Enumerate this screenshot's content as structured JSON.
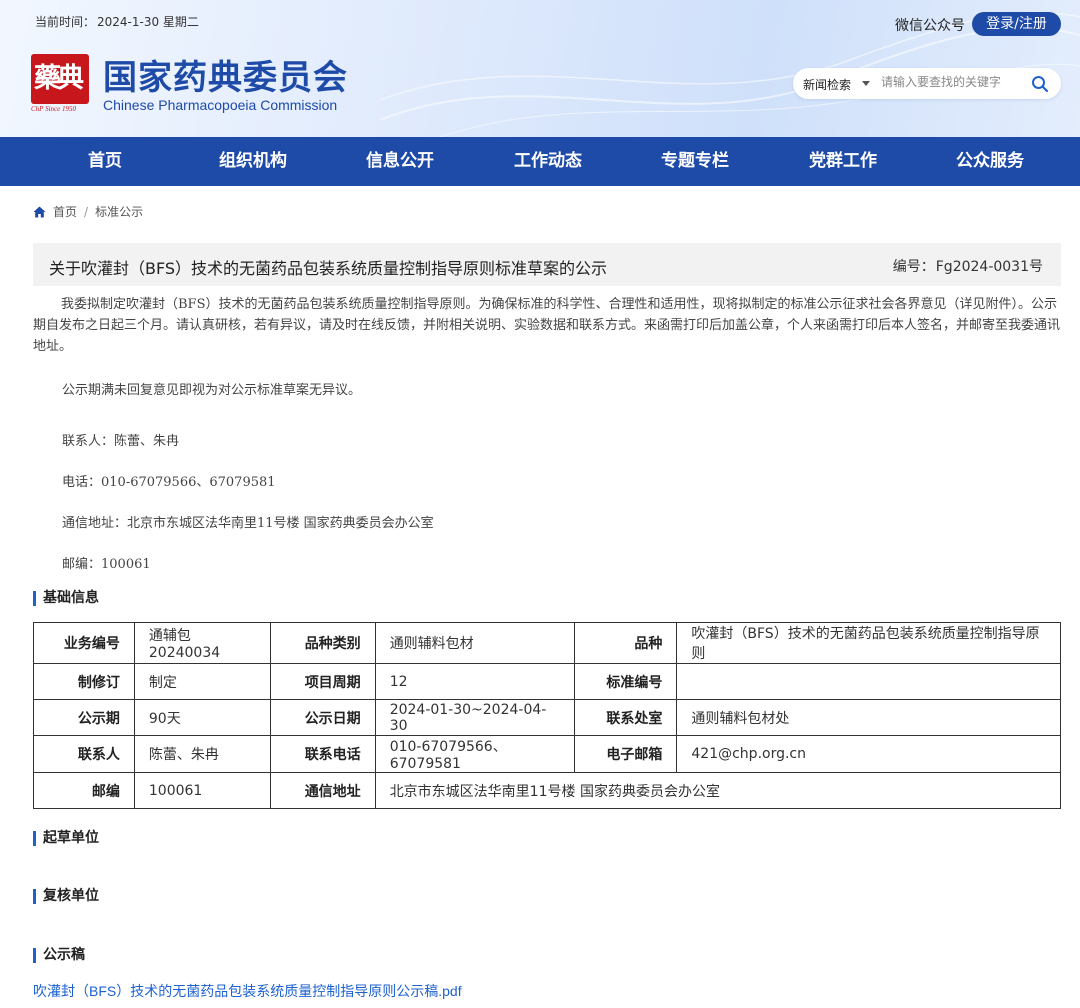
{
  "header": {
    "date_label": "当前时间：",
    "date_value": "2024-1-30 星期二",
    "seal_text": "藥典",
    "seal_sub": "ChP Since 1950",
    "logo_cn": "国家药典委员会",
    "logo_en": "Chinese Pharmacopoeia Commission",
    "wechat": "微信公众号",
    "login": "登录/注册",
    "search": {
      "category": "新闻检索",
      "placeholder": "请输入要查找的关键字"
    }
  },
  "nav": [
    "首页",
    "组织机构",
    "信息公开",
    "工作动态",
    "专题专栏",
    "党群工作",
    "公众服务"
  ],
  "breadcrumb": {
    "home": "首页",
    "sep": "/",
    "current": "标准公示"
  },
  "article": {
    "title": "关于吹灌封（BFS）技术的无菌药品包装系统质量控制指导原则标准草案的公示",
    "code_label": "编号：",
    "code": "Fg2024-0031号",
    "para": "我委拟制定吹灌封（BFS）技术的无菌药品包装系统质量控制指导原则。为确保标准的科学性、合理性和适用性，现将拟制定的标准公示征求社会各界意见（详见附件）。公示期自发布之日起三个月。请认真研核，若有异议，请及时在线反馈，并附相关说明、实验数据和联系方式。来函需打印后加盖公章，个人来函需打印后本人签名，并邮寄至我委通讯地址。",
    "line1": "公示期满未回复意见即视为对公示标准草案无异议。",
    "line2": "联系人：陈蕾、朱冉",
    "line3": "电话：010-67079566、67079581",
    "line4": "通信地址：北京市东城区法华南里11号楼 国家药典委员会办公室",
    "line5": "邮编：100061"
  },
  "sections": {
    "basic": "基础信息",
    "draft": "起草单位",
    "review": "复核单位",
    "doc": "公示稿"
  },
  "table": [
    [
      "业务编号",
      "通辅包20240034",
      "品种类别",
      "通则辅料包材",
      "品种",
      "吹灌封（BFS）技术的无菌药品包装系统质量控制指导原则"
    ],
    [
      "制修订",
      "制定",
      "项目周期",
      "12",
      "标准编号",
      ""
    ],
    [
      "公示期",
      "90天",
      "公示日期",
      "2024-01-30~2024-04-30",
      "联系处室",
      "通则辅料包材处"
    ],
    [
      "联系人",
      "陈蕾、朱冉",
      "联系电话",
      "010-67079566、67079581",
      "电子邮箱",
      "421@chp.org.cn"
    ],
    [
      "邮编",
      "100061",
      "通信地址",
      "北京市东城区法华南里11号楼 国家药典委员会办公室"
    ]
  ],
  "attachment": "吹灌封（BFS）技术的无菌药品包装系统质量控制指导原则公示稿.pdf",
  "colors": {
    "brand": "#1e4aa8",
    "accent": "#1e62d0",
    "seal": "#c8161d"
  }
}
